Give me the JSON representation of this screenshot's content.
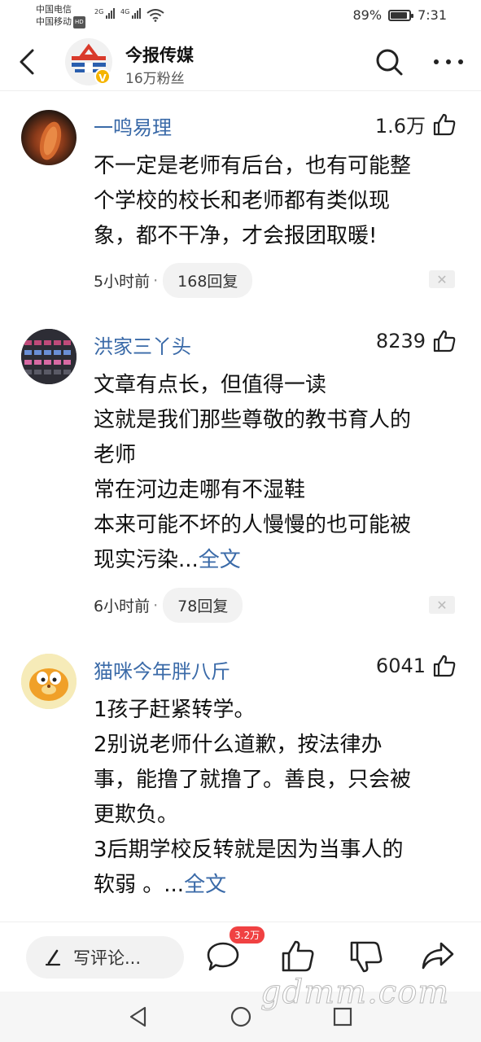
{
  "status_bar": {
    "carrier1": "中国电信",
    "carrier2": "中国移动",
    "hd": "HD",
    "sig1": "2G",
    "sig2": "4G",
    "battery": "89%",
    "battery_level": 0.89,
    "time": "7:31"
  },
  "header": {
    "title": "今报传媒",
    "fans": "16万粉丝",
    "verified": "V"
  },
  "comments": [
    {
      "name": "一鸣易理",
      "likes": "1.6万",
      "lines": [
        "不一定是老师有后台，也有可能整",
        "个学校的校长和老师都有类似现",
        "象，都不干净，才会报团取暖!"
      ],
      "time": "5小时前",
      "dot": "·",
      "replies": "168回复",
      "full": ""
    },
    {
      "name": "洪家三丫头",
      "likes": "8239",
      "lines": [
        "文章有点长，但值得一读",
        "这就是我们那些尊敬的教书育人的",
        "老师",
        "常在河边走哪有不湿鞋",
        "本来可能不坏的人慢慢的也可能被",
        "现实污染..."
      ],
      "time": "6小时前",
      "dot": "·",
      "replies": "78回复",
      "full": "全文"
    },
    {
      "name": "猫咪今年胖八斤",
      "likes": "6041",
      "lines": [
        "1孩子赶紧转学。",
        "2别说老师什么道歉，按法律办",
        "事，能撸了就撸了。善良，只会被",
        "更欺负。",
        "3后期学校反转就是因为当事人的",
        "软弱 。..."
      ],
      "time": "",
      "dot": "",
      "replies": "",
      "full": "全文"
    }
  ],
  "bottom_bar": {
    "write_label": "写评论...",
    "comment_count": "3.2万"
  },
  "watermark": "gdmm.com"
}
